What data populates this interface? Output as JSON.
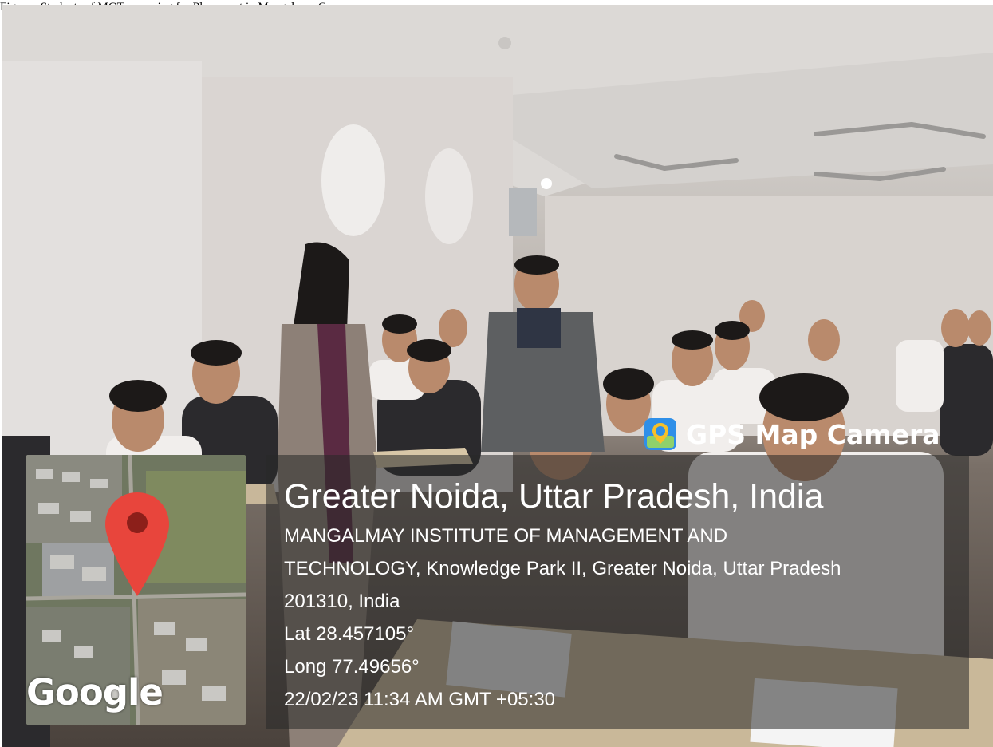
{
  "caption": "Figure : Students of MGT  preparing for Placement in Mangalmay Campus",
  "stamp": {
    "app_name": "GPS Map Camera",
    "app_icon": "gps-map-camera-icon",
    "location_title": "Greater Noida, Uttar Pradesh, India",
    "address_line_1": "MANGALMAY INSTITUTE OF MANAGEMENT AND",
    "address_line_2": "TECHNOLOGY, Knowledge Park II, Greater Noida, Uttar Pradesh",
    "address_line_3": "201310, India",
    "latitude": "Lat 28.457105°",
    "longitude": "Long 77.49656°",
    "timestamp": "22/02/23 11:34 AM GMT +05:30",
    "map_logo": "Google",
    "pin_icon": "map-pin-icon",
    "pin_color": "#e8453c"
  }
}
